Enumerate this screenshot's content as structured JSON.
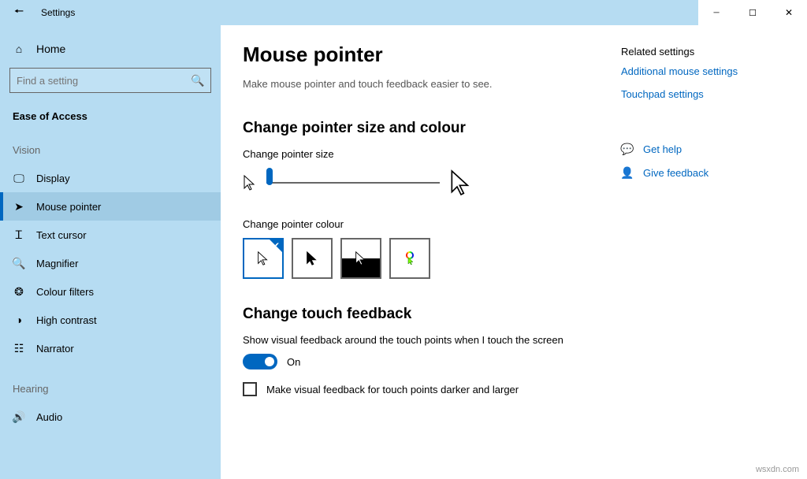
{
  "window": {
    "title": "Settings"
  },
  "sidebar": {
    "home": "Home",
    "search_placeholder": "Find a setting",
    "category": "Ease of Access",
    "sections": {
      "vision": {
        "label": "Vision",
        "items": [
          "Display",
          "Mouse pointer",
          "Text cursor",
          "Magnifier",
          "Colour filters",
          "High contrast",
          "Narrator"
        ],
        "selected": 1
      },
      "hearing": {
        "label": "Hearing",
        "items": [
          "Audio"
        ]
      }
    }
  },
  "page": {
    "title": "Mouse pointer",
    "description": "Make mouse pointer and touch feedback easier to see.",
    "section1": {
      "heading": "Change pointer size and colour",
      "size_label": "Change pointer size",
      "colour_label": "Change pointer colour"
    },
    "section2": {
      "heading": "Change touch feedback",
      "toggle_label": "Show visual feedback around the touch points when I touch the screen",
      "toggle_state": "On",
      "checkbox_label": "Make visual feedback for touch points darker and larger"
    }
  },
  "related": {
    "heading": "Related settings",
    "links": [
      "Additional mouse settings",
      "Touchpad settings"
    ],
    "help": "Get help",
    "feedback": "Give feedback"
  },
  "watermark": "wsxdn.com"
}
